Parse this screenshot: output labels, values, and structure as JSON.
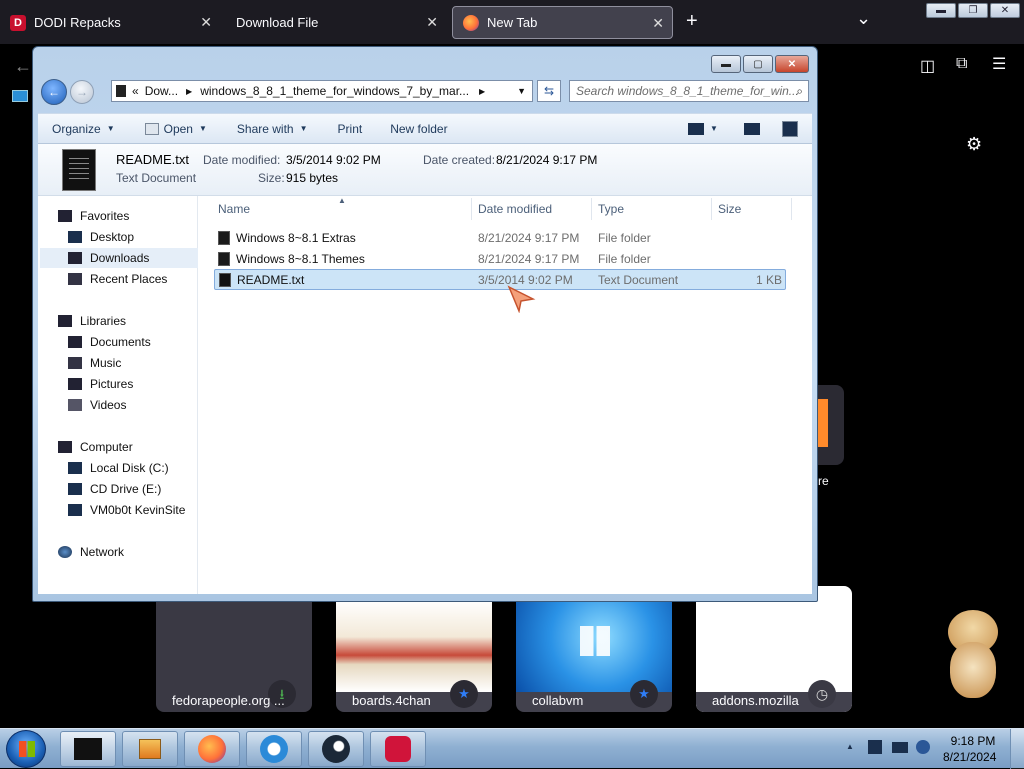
{
  "browser": {
    "tabs": [
      {
        "label": "DODI Repacks",
        "icon": "dodi-icon"
      },
      {
        "label": "Download File",
        "icon": ""
      },
      {
        "label": "New Tab",
        "icon": "firefox-icon"
      }
    ],
    "new_tab_symbol": "+",
    "list_tabs_symbol": "⌄",
    "tiles": [
      {
        "title": "fedorapeople.org ...",
        "badge": "download-icon"
      },
      {
        "title": "boards.4chan",
        "badge": "pin-icon"
      },
      {
        "title": "collabvm",
        "badge": "pin-icon"
      },
      {
        "title": "addons.mozilla",
        "badge": "clock-icon"
      }
    ],
    "partial_tile_text": "re"
  },
  "explorer": {
    "address": {
      "overflow": "«",
      "crumbs": [
        "Dow...",
        "windows_8_8_1_theme_for_windows_7_by_mar..."
      ]
    },
    "search_placeholder": "Search windows_8_8_1_theme_for_win...",
    "toolbar": {
      "organize": "Organize",
      "open": "Open",
      "share_with": "Share with",
      "print": "Print",
      "new_folder": "New folder"
    },
    "details": {
      "name": "README.txt",
      "type": "Text Document",
      "modified_label": "Date modified:",
      "modified_value": "3/5/2014 9:02 PM",
      "created_label": "Date created:",
      "created_value": "8/21/2024 9:17 PM",
      "size_label": "Size:",
      "size_value": "915 bytes"
    },
    "nav": {
      "favorites": "Favorites",
      "desktop": "Desktop",
      "downloads": "Downloads",
      "recent": "Recent Places",
      "libraries": "Libraries",
      "documents": "Documents",
      "music": "Music",
      "pictures": "Pictures",
      "videos": "Videos",
      "computer": "Computer",
      "local_disk": "Local Disk (C:)",
      "cd_drive": "CD Drive (E:)",
      "vm": "VM0b0t KevinSite",
      "network": "Network"
    },
    "columns": {
      "name": "Name",
      "date": "Date modified",
      "type": "Type",
      "size": "Size"
    },
    "files": [
      {
        "name": "Windows 8~8.1 Extras",
        "date": "8/21/2024 9:17 PM",
        "type": "File folder",
        "size": ""
      },
      {
        "name": "Windows 8~8.1 Themes",
        "date": "8/21/2024 9:17 PM",
        "type": "File folder",
        "size": ""
      },
      {
        "name": "README.txt",
        "date": "3/5/2014 9:02 PM",
        "type": "Text Document",
        "size": "1 KB"
      }
    ]
  },
  "taskbar": {
    "time": "9:18 PM",
    "date": "8/21/2024",
    "tray_arrow": "▲"
  },
  "colors": {
    "firefox_bg": "#1c1b22",
    "selection": "#cce4f7",
    "taskbar": "#8fb0d2"
  }
}
